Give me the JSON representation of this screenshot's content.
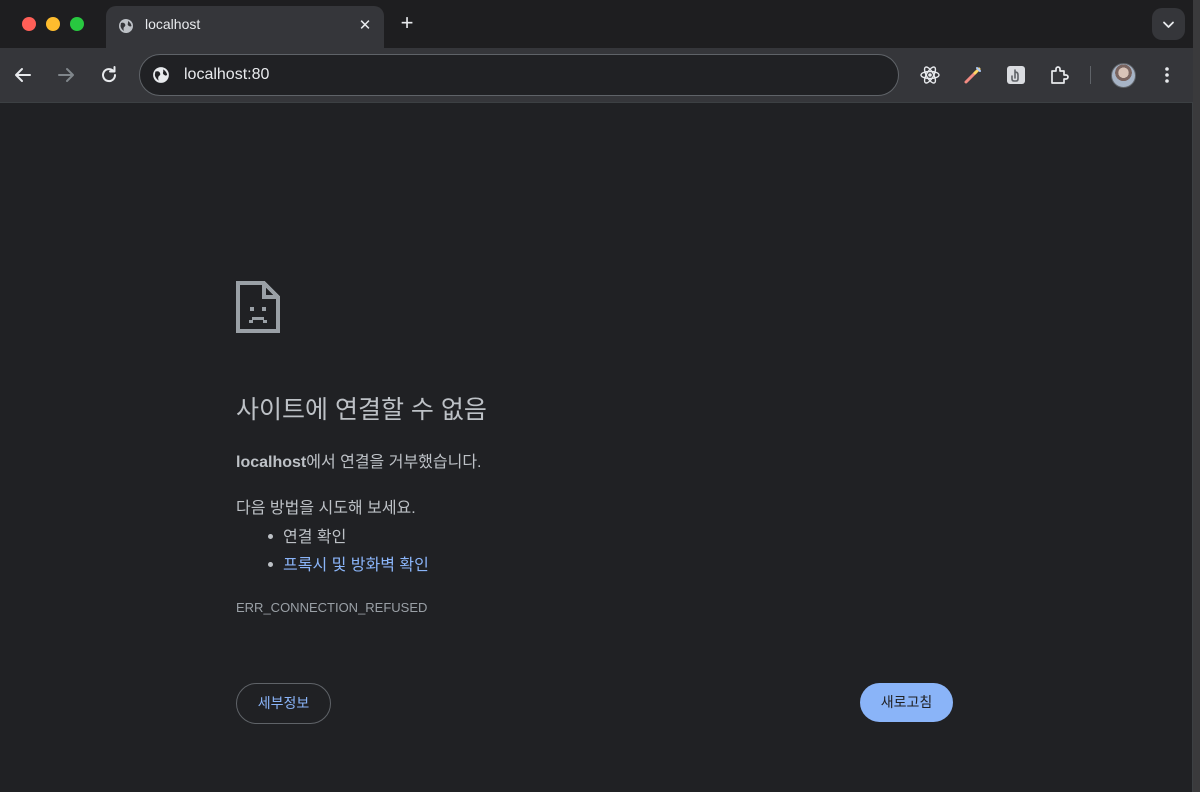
{
  "window_controls": {
    "close_color": "#ff5f57",
    "minimize_color": "#febc2e",
    "zoom_color": "#28c840"
  },
  "tab": {
    "title": "localhost",
    "icon": "globe-icon",
    "close_label": "✕"
  },
  "new_tab_label": "+",
  "toolbar": {
    "back_icon": "arrow-left-icon",
    "forward_icon": "arrow-right-icon",
    "reload_icon": "reload-icon",
    "site_info_icon": "globe-icon",
    "url": "localhost:80",
    "extensions": [
      "react-devtools-icon",
      "color-picker-icon",
      "screenshot-extension-icon",
      "puzzle-icon"
    ],
    "menu_icon": "more-vert-icon"
  },
  "error": {
    "icon": "sad-document-icon",
    "title": "사이트에 연결할 수 없음",
    "host": "localhost",
    "description_rest": "에서 연결을 거부했습니다.",
    "try_label": "다음 방법을 시도해 보세요.",
    "suggestions": [
      "연결 확인",
      "프록시 및 방화벽 확인"
    ],
    "code": "ERR_CONNECTION_REFUSED",
    "details_button": "세부정보",
    "reload_button": "새로고침"
  },
  "colors": {
    "page_background": "#202124",
    "toolbar_background": "#35363a",
    "link": "#8ab4f8",
    "primary_button": "#8ab4f8"
  }
}
